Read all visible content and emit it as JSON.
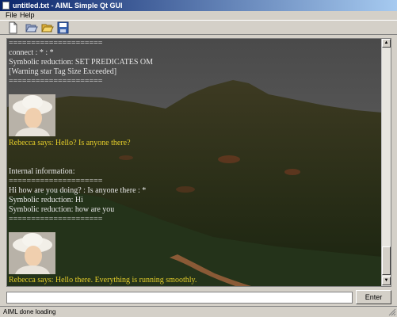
{
  "window": {
    "title": "untitled.txt - AIML Simple Qt GUI"
  },
  "menubar": {
    "items": [
      {
        "label": "File"
      },
      {
        "label": "Help"
      }
    ]
  },
  "toolbar": {
    "buttons": [
      {
        "icon": "new-file-icon"
      },
      {
        "icon": "open-folder-icon"
      },
      {
        "icon": "open-folder-icon"
      },
      {
        "icon": "save-disk-icon"
      }
    ]
  },
  "chat": {
    "lines": [
      {
        "text": "=====================",
        "color": "#e6e6e6"
      },
      {
        "text": "connect : * : *",
        "color": "#e6e6e6"
      },
      {
        "text": "Symbolic reduction: SET PREDICATES OM",
        "color": "#e6e6e6"
      },
      {
        "text": "[Warning star Tag Size Exceeded]",
        "color": "#e6e6e6"
      },
      {
        "text": "=====================",
        "color": "#e6e6e6"
      },
      {
        "text": "Rebecca says: Hello? Is anyone there?",
        "color": "#e6cf2a"
      },
      {
        "text": "Internal information:",
        "color": "#e6e6e6"
      },
      {
        "text": "=====================",
        "color": "#e6e6e6"
      },
      {
        "text": "Hi how are you doing? : Is anyone there : *",
        "color": "#e6e6e6"
      },
      {
        "text": "Symbolic reduction: Hi",
        "color": "#e6e6e6"
      },
      {
        "text": "Symbolic reduction: how are you",
        "color": "#e6e6e6"
      },
      {
        "text": "=====================",
        "color": "#e6e6e6"
      },
      {
        "text": "Rebecca says: Hello there. Everything is running smoothly.",
        "color": "#e6cf2a"
      }
    ],
    "avatar_icon": "rebecca-avatar"
  },
  "input": {
    "value": "",
    "placeholder": ""
  },
  "enter_button": {
    "label": "Enter"
  },
  "status": {
    "text": "AIML done loading"
  }
}
